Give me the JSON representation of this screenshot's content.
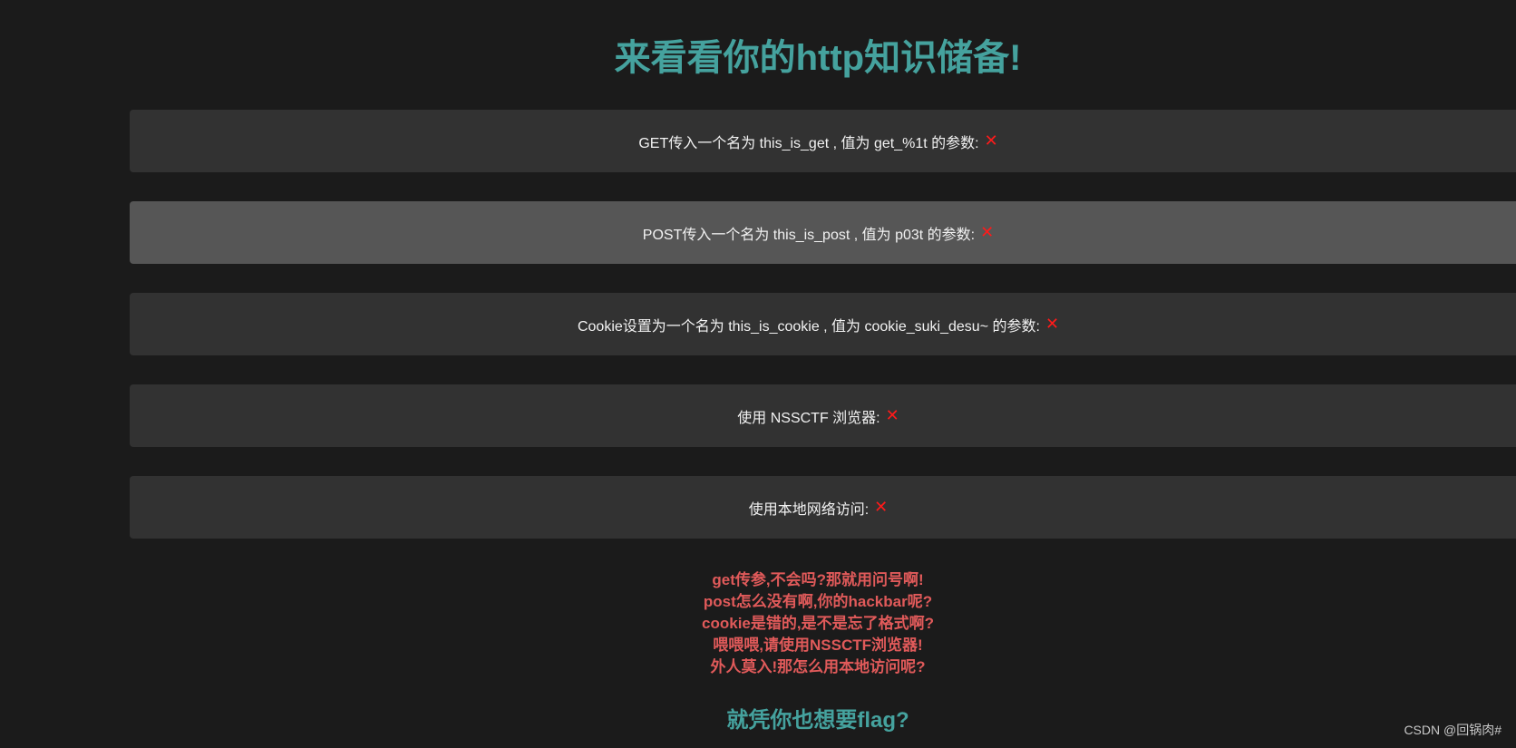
{
  "page_title": "来看看你的http知识储备!",
  "checks": [
    {
      "text": "GET传入一个名为 this_is_get ,  值为 get_%1t 的参数: ",
      "status": "✕"
    },
    {
      "text": "POST传入一个名为 this_is_post ,  值为 p03t 的参数: ",
      "status": "✕"
    },
    {
      "text": "Cookie设置为一个名为 this_is_cookie ,  值为 cookie_suki_desu~ 的参数: ",
      "status": "✕"
    },
    {
      "text": "使用 NSSCTF 浏览器: ",
      "status": "✕"
    },
    {
      "text": "使用本地网络访问: ",
      "status": "✕"
    }
  ],
  "hints": [
    "get传参,不会吗?那就用问号啊!",
    "post怎么没有啊,你的hackbar呢?",
    "cookie是错的,是不是忘了格式啊?",
    "喂喂喂,请使用NSSCTF浏览器!",
    "外人莫入!那怎么用本地访问呢?"
  ],
  "footer_question": "就凭你也想要flag?",
  "watermark": "CSDN @回锅肉#",
  "colors": {
    "background": "#1b1b1b",
    "card": "#323232",
    "card_highlight": "#565656",
    "accent": "#45a29e",
    "error": "#ff1a1a",
    "hint": "#e05a5a"
  },
  "icons": {
    "status": "close-icon"
  }
}
